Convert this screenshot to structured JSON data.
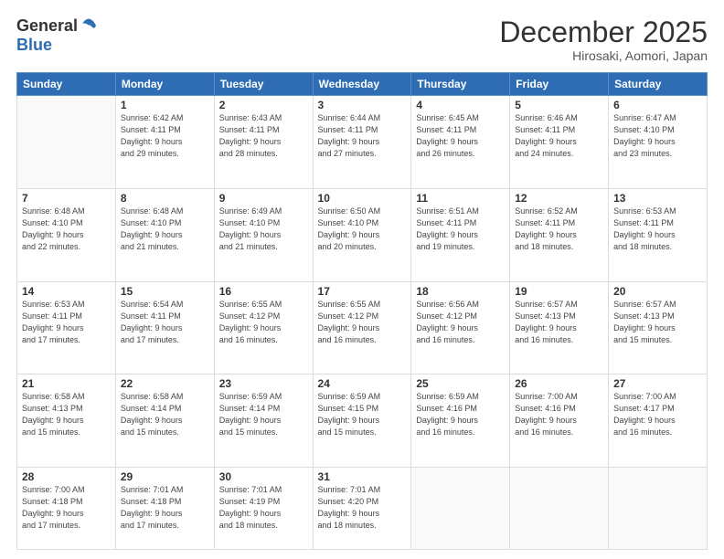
{
  "logo": {
    "general": "General",
    "blue": "Blue"
  },
  "header": {
    "month": "December 2025",
    "location": "Hirosaki, Aomori, Japan"
  },
  "days": [
    "Sunday",
    "Monday",
    "Tuesday",
    "Wednesday",
    "Thursday",
    "Friday",
    "Saturday"
  ],
  "weeks": [
    [
      {
        "day": "",
        "info": ""
      },
      {
        "day": "1",
        "info": "Sunrise: 6:42 AM\nSunset: 4:11 PM\nDaylight: 9 hours\nand 29 minutes."
      },
      {
        "day": "2",
        "info": "Sunrise: 6:43 AM\nSunset: 4:11 PM\nDaylight: 9 hours\nand 28 minutes."
      },
      {
        "day": "3",
        "info": "Sunrise: 6:44 AM\nSunset: 4:11 PM\nDaylight: 9 hours\nand 27 minutes."
      },
      {
        "day": "4",
        "info": "Sunrise: 6:45 AM\nSunset: 4:11 PM\nDaylight: 9 hours\nand 26 minutes."
      },
      {
        "day": "5",
        "info": "Sunrise: 6:46 AM\nSunset: 4:11 PM\nDaylight: 9 hours\nand 24 minutes."
      },
      {
        "day": "6",
        "info": "Sunrise: 6:47 AM\nSunset: 4:10 PM\nDaylight: 9 hours\nand 23 minutes."
      }
    ],
    [
      {
        "day": "7",
        "info": "Sunrise: 6:48 AM\nSunset: 4:10 PM\nDaylight: 9 hours\nand 22 minutes."
      },
      {
        "day": "8",
        "info": "Sunrise: 6:48 AM\nSunset: 4:10 PM\nDaylight: 9 hours\nand 21 minutes."
      },
      {
        "day": "9",
        "info": "Sunrise: 6:49 AM\nSunset: 4:10 PM\nDaylight: 9 hours\nand 21 minutes."
      },
      {
        "day": "10",
        "info": "Sunrise: 6:50 AM\nSunset: 4:10 PM\nDaylight: 9 hours\nand 20 minutes."
      },
      {
        "day": "11",
        "info": "Sunrise: 6:51 AM\nSunset: 4:11 PM\nDaylight: 9 hours\nand 19 minutes."
      },
      {
        "day": "12",
        "info": "Sunrise: 6:52 AM\nSunset: 4:11 PM\nDaylight: 9 hours\nand 18 minutes."
      },
      {
        "day": "13",
        "info": "Sunrise: 6:53 AM\nSunset: 4:11 PM\nDaylight: 9 hours\nand 18 minutes."
      }
    ],
    [
      {
        "day": "14",
        "info": "Sunrise: 6:53 AM\nSunset: 4:11 PM\nDaylight: 9 hours\nand 17 minutes."
      },
      {
        "day": "15",
        "info": "Sunrise: 6:54 AM\nSunset: 4:11 PM\nDaylight: 9 hours\nand 17 minutes."
      },
      {
        "day": "16",
        "info": "Sunrise: 6:55 AM\nSunset: 4:12 PM\nDaylight: 9 hours\nand 16 minutes."
      },
      {
        "day": "17",
        "info": "Sunrise: 6:55 AM\nSunset: 4:12 PM\nDaylight: 9 hours\nand 16 minutes."
      },
      {
        "day": "18",
        "info": "Sunrise: 6:56 AM\nSunset: 4:12 PM\nDaylight: 9 hours\nand 16 minutes."
      },
      {
        "day": "19",
        "info": "Sunrise: 6:57 AM\nSunset: 4:13 PM\nDaylight: 9 hours\nand 16 minutes."
      },
      {
        "day": "20",
        "info": "Sunrise: 6:57 AM\nSunset: 4:13 PM\nDaylight: 9 hours\nand 15 minutes."
      }
    ],
    [
      {
        "day": "21",
        "info": "Sunrise: 6:58 AM\nSunset: 4:13 PM\nDaylight: 9 hours\nand 15 minutes."
      },
      {
        "day": "22",
        "info": "Sunrise: 6:58 AM\nSunset: 4:14 PM\nDaylight: 9 hours\nand 15 minutes."
      },
      {
        "day": "23",
        "info": "Sunrise: 6:59 AM\nSunset: 4:14 PM\nDaylight: 9 hours\nand 15 minutes."
      },
      {
        "day": "24",
        "info": "Sunrise: 6:59 AM\nSunset: 4:15 PM\nDaylight: 9 hours\nand 15 minutes."
      },
      {
        "day": "25",
        "info": "Sunrise: 6:59 AM\nSunset: 4:16 PM\nDaylight: 9 hours\nand 16 minutes."
      },
      {
        "day": "26",
        "info": "Sunrise: 7:00 AM\nSunset: 4:16 PM\nDaylight: 9 hours\nand 16 minutes."
      },
      {
        "day": "27",
        "info": "Sunrise: 7:00 AM\nSunset: 4:17 PM\nDaylight: 9 hours\nand 16 minutes."
      }
    ],
    [
      {
        "day": "28",
        "info": "Sunrise: 7:00 AM\nSunset: 4:18 PM\nDaylight: 9 hours\nand 17 minutes."
      },
      {
        "day": "29",
        "info": "Sunrise: 7:01 AM\nSunset: 4:18 PM\nDaylight: 9 hours\nand 17 minutes."
      },
      {
        "day": "30",
        "info": "Sunrise: 7:01 AM\nSunset: 4:19 PM\nDaylight: 9 hours\nand 18 minutes."
      },
      {
        "day": "31",
        "info": "Sunrise: 7:01 AM\nSunset: 4:20 PM\nDaylight: 9 hours\nand 18 minutes."
      },
      {
        "day": "",
        "info": ""
      },
      {
        "day": "",
        "info": ""
      },
      {
        "day": "",
        "info": ""
      }
    ]
  ]
}
